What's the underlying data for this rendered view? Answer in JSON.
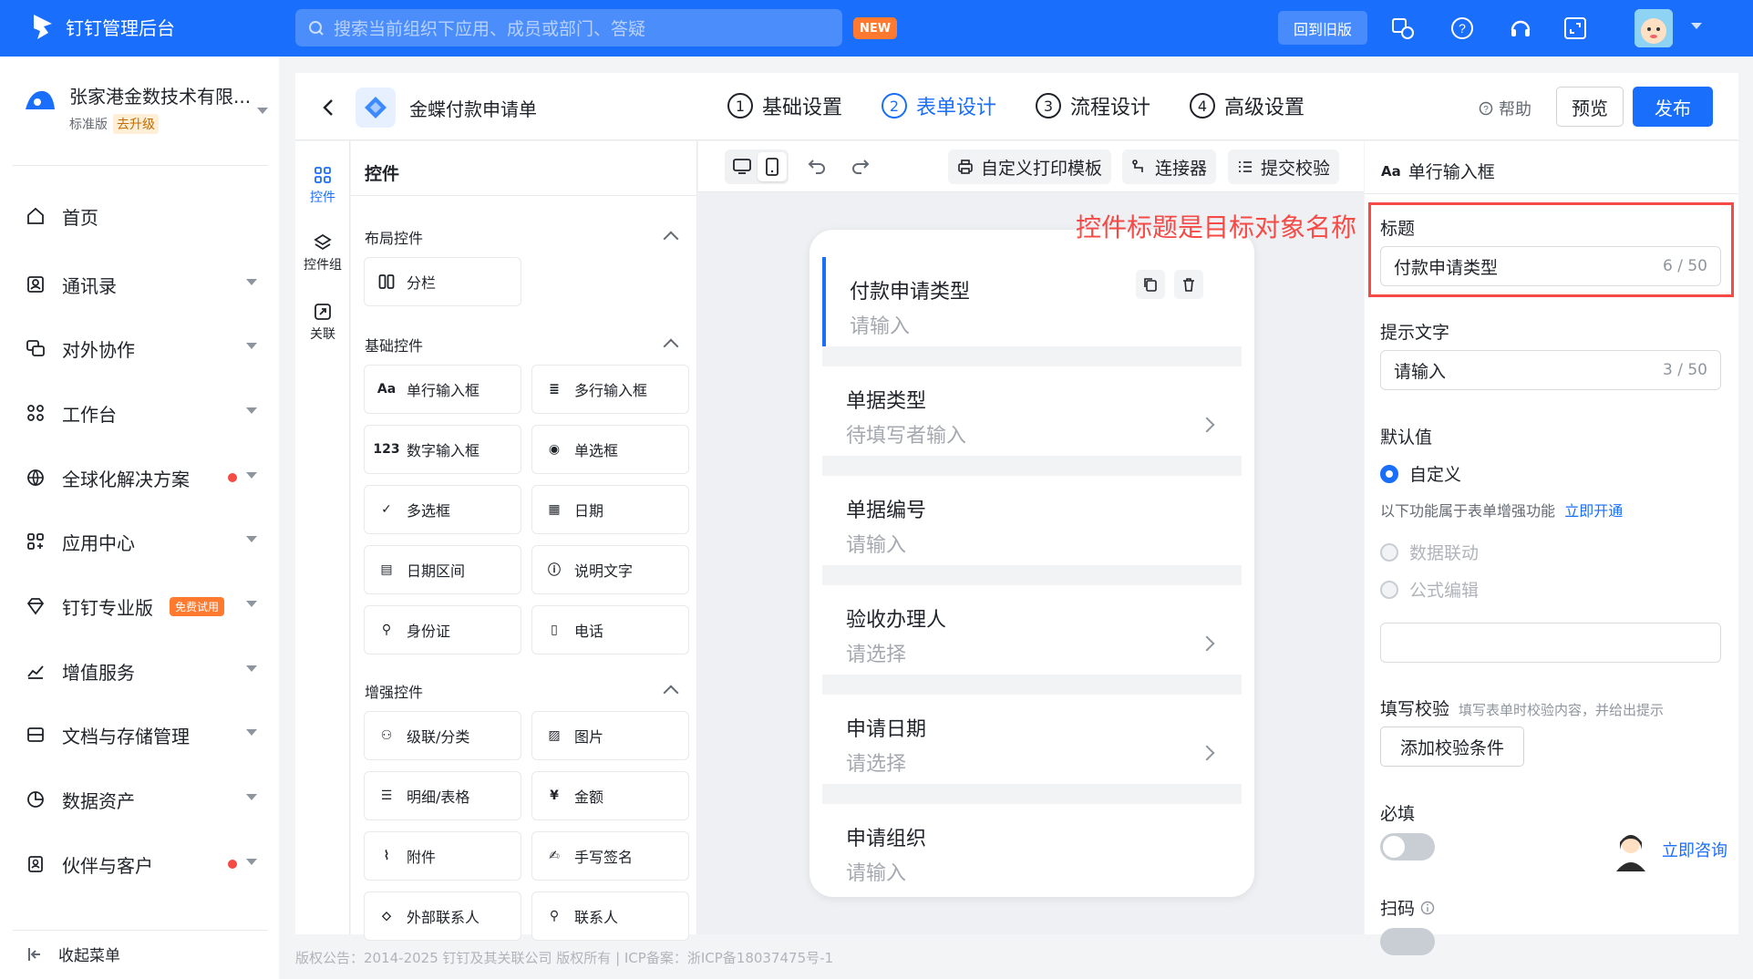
{
  "brand": {
    "title": "钉钉管理后台"
  },
  "search": {
    "placeholder": "搜索当前组织下应用、成员或部门、答疑",
    "badge": "NEW"
  },
  "topbar": {
    "old_version": "回到旧版"
  },
  "org": {
    "name": "张家港金数技术有限...",
    "edition": "标准版",
    "upgrade": "去升级"
  },
  "nav": [
    {
      "label": "首页",
      "icon": "home-icon"
    },
    {
      "label": "通讯录",
      "icon": "contacts-icon"
    },
    {
      "label": "对外协作",
      "icon": "collaboration-icon"
    },
    {
      "label": "工作台",
      "icon": "workbench-icon"
    },
    {
      "label": "全球化解决方案",
      "icon": "globe-icon"
    },
    {
      "label": "应用中心",
      "icon": "apps-icon"
    },
    {
      "label": "钉钉专业版",
      "icon": "diamond-icon",
      "badge": "免费试用"
    },
    {
      "label": "增值服务",
      "icon": "chart-icon"
    },
    {
      "label": "文档与存储管理",
      "icon": "storage-icon"
    },
    {
      "label": "数据资产",
      "icon": "data-icon"
    },
    {
      "label": "伙伴与客户",
      "icon": "partner-icon"
    }
  ],
  "collapse_menu": "收起菜单",
  "header": {
    "form_name": "金蝶付款申请单",
    "steps": [
      {
        "num": "1",
        "label": "基础设置"
      },
      {
        "num": "2",
        "label": "表单设计"
      },
      {
        "num": "3",
        "label": "流程设计"
      },
      {
        "num": "4",
        "label": "高级设置"
      }
    ],
    "help": "帮助",
    "preview": "预览",
    "publish": "发布"
  },
  "rail": [
    {
      "label": "控件"
    },
    {
      "label": "控件组"
    },
    {
      "label": "关联"
    }
  ],
  "controls": {
    "title": "控件",
    "layout_section": "布局控件",
    "layout": [
      {
        "label": "分栏",
        "icon": "columns-icon"
      }
    ],
    "basic_section": "基础控件",
    "basic": [
      {
        "label": "单行输入框",
        "icon": "text-input-icon",
        "glyph": "Aa"
      },
      {
        "label": "多行输入框",
        "icon": "textarea-icon",
        "glyph": "≣"
      },
      {
        "label": "数字输入框",
        "icon": "number-icon",
        "glyph": "123"
      },
      {
        "label": "单选框",
        "icon": "radio-icon",
        "glyph": "◉"
      },
      {
        "label": "多选框",
        "icon": "checkbox-icon",
        "glyph": "✓"
      },
      {
        "label": "日期",
        "icon": "date-icon",
        "glyph": "▦"
      },
      {
        "label": "日期区间",
        "icon": "date-range-icon",
        "glyph": "▤"
      },
      {
        "label": "说明文字",
        "icon": "info-icon",
        "glyph": "ⓘ"
      },
      {
        "label": "身份证",
        "icon": "id-card-icon",
        "glyph": "⚲"
      },
      {
        "label": "电话",
        "icon": "phone-icon",
        "glyph": "▯"
      }
    ],
    "enhanced_section": "增强控件",
    "enhanced": [
      {
        "label": "级联/分类",
        "icon": "cascade-icon",
        "glyph": "⚇"
      },
      {
        "label": "图片",
        "icon": "image-icon",
        "glyph": "▨"
      },
      {
        "label": "明细/表格",
        "icon": "table-icon",
        "glyph": "☰"
      },
      {
        "label": "金额",
        "icon": "money-icon",
        "glyph": "¥"
      },
      {
        "label": "附件",
        "icon": "attachment-icon",
        "glyph": "⌇"
      },
      {
        "label": "手写签名",
        "icon": "signature-icon",
        "glyph": "✍"
      },
      {
        "label": "外部联系人",
        "icon": "external-contact-icon",
        "glyph": "⬦"
      },
      {
        "label": "联系人",
        "icon": "contact-icon",
        "glyph": "⚲"
      }
    ]
  },
  "toolbar": {
    "print_template": "自定义打印模板",
    "connector": "连接器",
    "submit_check": "提交校验"
  },
  "form_fields": [
    {
      "label": "付款申请类型",
      "placeholder": "请输入",
      "chevron": false
    },
    {
      "label": "单据类型",
      "placeholder": "待填写者输入",
      "chevron": true
    },
    {
      "label": "单据编号",
      "placeholder": "请输入",
      "chevron": false
    },
    {
      "label": "验收办理人",
      "placeholder": "请选择",
      "chevron": true
    },
    {
      "label": "申请日期",
      "placeholder": "请选择",
      "chevron": true
    },
    {
      "label": "申请组织",
      "placeholder": "请输入",
      "chevron": false
    }
  ],
  "annotation": "控件标题是目标对象名称",
  "props": {
    "type": "单行输入框",
    "title_label": "标题",
    "title_value": "付款申请类型",
    "title_count": "6 / 50",
    "hint_label": "提示文字",
    "hint_value": "请输入",
    "hint_count": "3 / 50",
    "default_label": "默认值",
    "default_custom": "自定义",
    "enhance_note": "以下功能属于表单增强功能",
    "enhance_link": "立即开通",
    "linkage": "数据联动",
    "formula": "公式编辑",
    "validate_label": "填写校验",
    "validate_desc": "填写表单时校验内容，并给出提示",
    "add_rule": "添加校验条件",
    "required_label": "必填",
    "required": false,
    "scan_label": "扫码"
  },
  "consult": "立即咨询",
  "footer": "版权公告：2014-2025 钉钉及其关联公司 版权所有 | ICP备案：浙ICP备18037475号-1",
  "colors": {
    "primary": "#1a6efc",
    "danger": "#f54a45",
    "orange": "#ff7a2e"
  }
}
